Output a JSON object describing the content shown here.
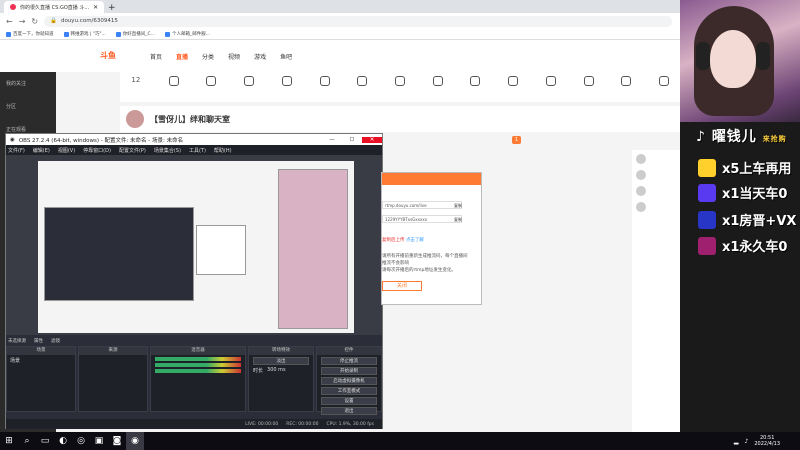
{
  "browser": {
    "tabs": [
      {
        "title": "你的很久直播 CS:GO直播 斗..."
      },
      {
        "title": ""
      }
    ],
    "url": "douyu.com/6309415",
    "bookmarks": [
      "百度一下，你就知道",
      "韩维游戏 | \"巧\"...",
      "你好直播间_C...",
      "个人邮箱_邮件服..."
    ]
  },
  "site": {
    "logo": "斗鱼",
    "nav": [
      "首页",
      "直播",
      "分类",
      "视频",
      "游戏",
      "鱼吧"
    ],
    "active_nav": "直播",
    "categories": [
      "12",
      "",
      "",
      "",
      "",
      "",
      "",
      "",
      "",
      "",
      "",
      "",
      "",
      "",
      "",
      "",
      "",
      ""
    ],
    "room_title": "【雪伢儿】绊和聊天室",
    "rank_badge": "1",
    "left_nav": [
      "我的关注",
      "分区",
      "正在观看"
    ]
  },
  "overlay": {
    "tiktok_name": "曜钱儿",
    "tiktok_tag": "来抢购",
    "rewards": [
      "x5上车再用",
      "x1当天车0",
      "x1房晋+VX",
      "x1永久车0"
    ]
  },
  "obs": {
    "title": "OBS 27.2.4 (64-bit, windows) - 配置文件: 未命名 - 场景: 未命名",
    "menu": [
      "文件(F)",
      "编辑(E)",
      "视图(V)",
      "停靠窗口(D)",
      "配置文件(P)",
      "场景集合(S)",
      "工具(T)",
      "帮助(H)"
    ],
    "scene_bar": [
      "未选择源",
      "属性",
      "滤镜"
    ],
    "docks": [
      "场景",
      "来源",
      "混音器",
      "转场特效",
      "控件"
    ],
    "scene_items": [
      "场景"
    ],
    "source_items": [
      "",
      "",
      "",
      "",
      "",
      ""
    ],
    "transition": {
      "type": "淡出",
      "label": "时长",
      "value": "300 ms"
    },
    "controls": [
      "停止推流",
      "开始录制",
      "启动虚拟摄像机",
      "工作室模式",
      "设置",
      "退出"
    ],
    "status": {
      "live": "LIVE: 00:00:00",
      "rec": "REC: 00:00:00",
      "cpu": "CPU: 1.9%, 30.00 fps"
    }
  },
  "dialog": {
    "server": "rtmp.douyu.com/live",
    "key": "1229YYYBTxsGxxxxx",
    "copy_label": "复制",
    "note1": "复制后上传",
    "note2": "点击了解",
    "line3": "请所有开播前重新生成推流码，每个直播间",
    "line4": "推流不会影响",
    "line5": "请每次开播后的rtmp地址发生变化。",
    "button": "关闭"
  },
  "taskbar": {
    "time": "20:51",
    "date": "2022/4/13"
  }
}
